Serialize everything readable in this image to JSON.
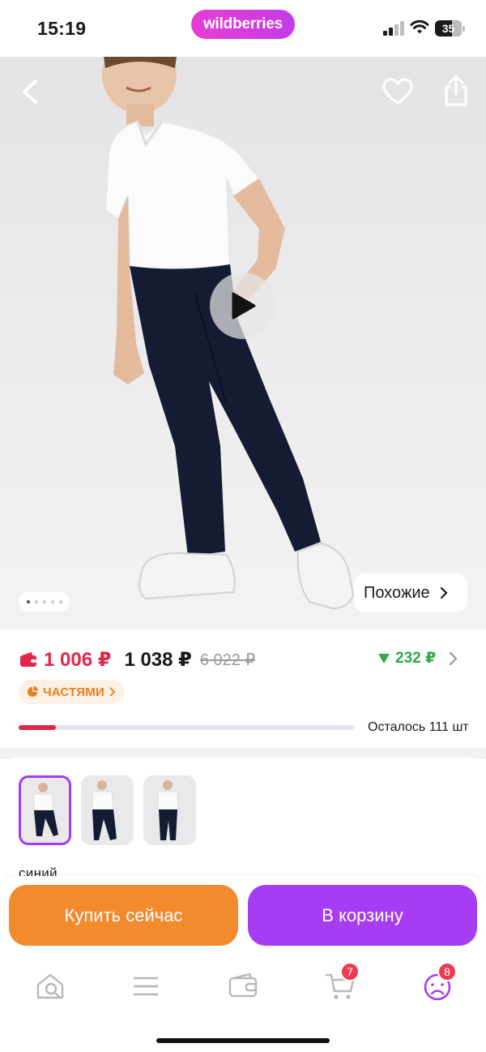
{
  "status_bar": {
    "time": "15:19",
    "brand": "wildberries",
    "battery": "35",
    "icons": [
      "signal-icon",
      "wifi-icon",
      "battery-icon"
    ]
  },
  "gallery": {
    "icons": [
      "back-chevron-icon",
      "heart-icon",
      "share-icon",
      "play-icon"
    ],
    "image_count": 5,
    "active_image": 1,
    "similar_label": "Похожие"
  },
  "price": {
    "wallet_price": "1 006 ₽",
    "price": "1 038 ₽",
    "old_price": "6 022 ₽",
    "discount": "232 ₽",
    "parts_label": "ЧАСТЯМИ",
    "stock_text": "Осталось 111 шт",
    "stock_fraction": 0.11
  },
  "colors": {
    "thumbnail_count": 3,
    "selected_index": 0,
    "color_name": "синий"
  },
  "actions": {
    "buy_now": "Купить сейчас",
    "add_to_cart": "В корзину"
  },
  "tabs": {
    "items": [
      "home-search-icon",
      "catalog-menu-icon",
      "wallet-icon",
      "cart-icon",
      "profile-icon"
    ],
    "cart_badge": "7",
    "profile_badge": "8"
  },
  "colors_theme": {
    "brand_pink": "#e63fd2",
    "price_red": "#e3274b",
    "discount_green": "#2fa84f",
    "buy_orange": "#f28a2e",
    "cart_purple": "#a73df2",
    "badge_red": "#f03a55"
  }
}
